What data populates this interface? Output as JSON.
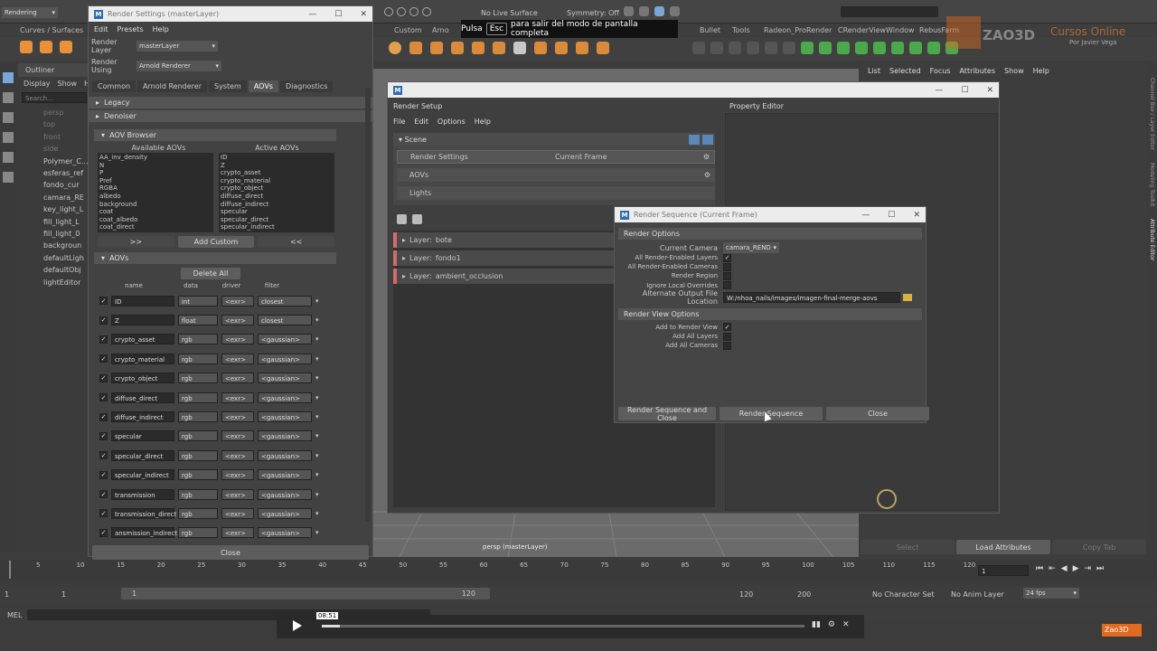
{
  "top": {
    "mode": "Rendering",
    "live": "No Live Surface",
    "symmetry": "Symmetry: Off"
  },
  "shelf_tabs": [
    "Curves / Surfaces",
    "Custom",
    "Arno",
    "Bullet",
    "Tools",
    "Radeon_ProRender",
    "CRenderViewWindow",
    "RebusFarm"
  ],
  "fullscreen": {
    "pre": "Pulsa",
    "key": "Esc",
    "post": "para salir del modo de pantalla completa"
  },
  "brand": {
    "logo": "ZAO3D",
    "course": "Cursos Online",
    "author": "Por Javier Vega",
    "small": "Zao3D"
  },
  "outliner": {
    "title": "Outliner",
    "menu": [
      "Display",
      "Show",
      "Help"
    ],
    "search": "Search...",
    "items": [
      "persp",
      "top",
      "front",
      "side",
      "Polymer_C...",
      "esferas_ref",
      "fondo_cur",
      "camara_RE",
      "key_light_L",
      "fill_light_L",
      "fill_light_0",
      "backgroun",
      "defaultLigh",
      "defaultObj",
      "lightEditor"
    ]
  },
  "render_settings": {
    "title": "Render Settings (masterLayer)",
    "menu": [
      "Edit",
      "Presets",
      "Help"
    ],
    "layer_label": "Render Layer",
    "layer_value": "masterLayer",
    "using_label": "Render Using",
    "using_value": "Arnold Renderer",
    "tabs": [
      "Common",
      "Arnold Renderer",
      "System",
      "AOVs",
      "Diagnostics"
    ],
    "legacy": "Legacy",
    "denoiser": "Denoiser",
    "aov_browser": "AOV Browser",
    "available_label": "Available AOVs",
    "active_label": "Active AOVs",
    "available": [
      "AA_inv_density",
      "N",
      "P",
      "Pref",
      "RGBA",
      "albedo",
      "background",
      "coat",
      "coat_albedo",
      "coat_direct"
    ],
    "active": [
      "ID",
      "Z",
      "crypto_asset",
      "crypto_material",
      "crypto_object",
      "diffuse_direct",
      "diffuse_indirect",
      "specular",
      "specular_direct",
      "specular_indirect"
    ],
    "add_btn": ">>",
    "add_custom": "Add Custom",
    "remove_btn": "<<",
    "aovs_section": "AOVs",
    "delete_all": "Delete All",
    "col_name": "name",
    "col_data": "data",
    "col_driver": "driver",
    "col_filter": "filter",
    "rows": [
      {
        "name": "ID",
        "data": "int",
        "driver": "<exr>",
        "filter": "closest"
      },
      {
        "name": "Z",
        "data": "float",
        "driver": "<exr>",
        "filter": "closest"
      },
      {
        "name": "crypto_asset",
        "data": "rgb",
        "driver": "<exr>",
        "filter": "<gaussian>"
      },
      {
        "name": "crypto_material",
        "data": "rgb",
        "driver": "<exr>",
        "filter": "<gaussian>"
      },
      {
        "name": "crypto_object",
        "data": "rgb",
        "driver": "<exr>",
        "filter": "<gaussian>"
      },
      {
        "name": "diffuse_direct",
        "data": "rgb",
        "driver": "<exr>",
        "filter": "<gaussian>"
      },
      {
        "name": "diffuse_indirect",
        "data": "rgb",
        "driver": "<exr>",
        "filter": "<gaussian>"
      },
      {
        "name": "specular",
        "data": "rgb",
        "driver": "<exr>",
        "filter": "<gaussian>"
      },
      {
        "name": "specular_direct",
        "data": "rgb",
        "driver": "<exr>",
        "filter": "<gaussian>"
      },
      {
        "name": "specular_indirect",
        "data": "rgb",
        "driver": "<exr>",
        "filter": "<gaussian>"
      },
      {
        "name": "transmission",
        "data": "rgb",
        "driver": "<exr>",
        "filter": "<gaussian>"
      },
      {
        "name": "transmission_direct",
        "data": "rgb",
        "driver": "<exr>",
        "filter": "<gaussian>"
      },
      {
        "name": "ansmission_indirect",
        "data": "rgb",
        "driver": "<exr>",
        "filter": "<gaussian>"
      }
    ],
    "close": "Close"
  },
  "render_setup": {
    "title": "Render Setup",
    "menu": [
      "File",
      "Edit",
      "Options",
      "Help"
    ],
    "property_editor": "Property Editor",
    "scene": "Scene",
    "rows": [
      {
        "label": "Render Settings",
        "value": "Current Frame"
      },
      {
        "label": "AOVs",
        "value": ""
      },
      {
        "label": "Lights",
        "value": ""
      }
    ],
    "layers": [
      {
        "prefix": "Layer:",
        "name": "bote"
      },
      {
        "prefix": "Layer:",
        "name": "fondo1"
      },
      {
        "prefix": "Layer:",
        "name": "ambient_occlusion"
      }
    ]
  },
  "render_sequence": {
    "title": "Render Sequence (Current Frame)",
    "options_header": "Render Options",
    "camera_label": "Current Camera",
    "camera_value": "camara_REND",
    "opts": [
      {
        "label": "All Render-Enabled Layers",
        "checked": true
      },
      {
        "label": "All Render-Enabled Cameras",
        "checked": false
      },
      {
        "label": "Render Region",
        "checked": false
      },
      {
        "label": "Ignore Local Overrides",
        "checked": false
      }
    ],
    "output_label": "Alternate Output File Location",
    "output_value": "W:/nhoa_nails/images/imagen-final-merge-aovs",
    "view_header": "Render View Options",
    "view_opts": [
      {
        "label": "Add to Render View",
        "checked": true
      },
      {
        "label": "Add All Layers",
        "checked": false
      },
      {
        "label": "Add All Cameras",
        "checked": false
      }
    ],
    "btn_seq_close": "Render Sequence and Close",
    "btn_seq": "Render Sequence",
    "btn_close": "Close"
  },
  "right_panel": {
    "menu": [
      "List",
      "Selected",
      "Focus",
      "Attributes",
      "Show",
      "Help"
    ],
    "side_tabs": [
      "Channel Box / Layer Editor",
      "Modeling Toolkit",
      "Attribute Editor"
    ],
    "bottom": [
      "Select",
      "Load Attributes",
      "Copy Tab"
    ]
  },
  "viewport": {
    "label": "persp (masterLayer)"
  },
  "timeline": {
    "ticks": [
      "5",
      "10",
      "15",
      "20",
      "25",
      "30",
      "35",
      "40",
      "45",
      "50",
      "55",
      "60",
      "65",
      "70",
      "75",
      "80",
      "85",
      "90",
      "95",
      "100",
      "105",
      "110",
      "115",
      "120"
    ],
    "frame": "1",
    "start": "1",
    "range_start": "1",
    "range_val": "1",
    "range_end": "120",
    "end1": "120",
    "end2": "200",
    "char_set": "No Character Set",
    "anim_layer": "No Anim Layer",
    "fps": "24 fps",
    "mel": "MEL"
  },
  "video": {
    "time": "08:51",
    "progress": 0.038
  }
}
